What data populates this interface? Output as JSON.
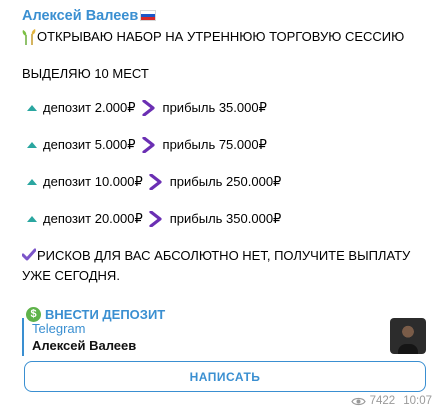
{
  "message": {
    "author": "Алексей Валеев",
    "flag_icon": "russia-flag-icon",
    "line1": "ОТКРЫВАЮ НАБОР НА УТРЕННЮЮ ТОРГОВУЮ СЕССИЮ",
    "line2": "ВЫДЕЛЯЮ 10 МЕСТ",
    "offers": [
      {
        "deposit": "депозит 2.000₽",
        "profit": "прибыль 35.000₽"
      },
      {
        "deposit": "депозит 5.000₽",
        "profit": "прибыль 75.000₽"
      },
      {
        "deposit": "депозит 10.000₽",
        "profit": "прибыль 250.000₽"
      },
      {
        "deposit": "депозит 20.000₽",
        "profit": "прибыль 350.000₽"
      }
    ],
    "warning": "РИСКОВ ДЛЯ ВАС АБСОЛЮТНО НЕТ, ПОЛУЧИТЕ ВЫПЛАТУ УЖЕ СЕГОДНЯ.",
    "deposit_link": "ВНЕСТИ ДЕПОЗИТ"
  },
  "preview": {
    "site": "Telegram",
    "title": "Алексей Валеев"
  },
  "button": {
    "label": "НАПИСАТЬ"
  },
  "meta": {
    "views": "7422",
    "time": "10:07"
  },
  "colors": {
    "accent": "#3a8fd1",
    "triangle": "#2aa6a0",
    "chevron": "#6b2fb3",
    "dollar": "#5fb34a"
  }
}
